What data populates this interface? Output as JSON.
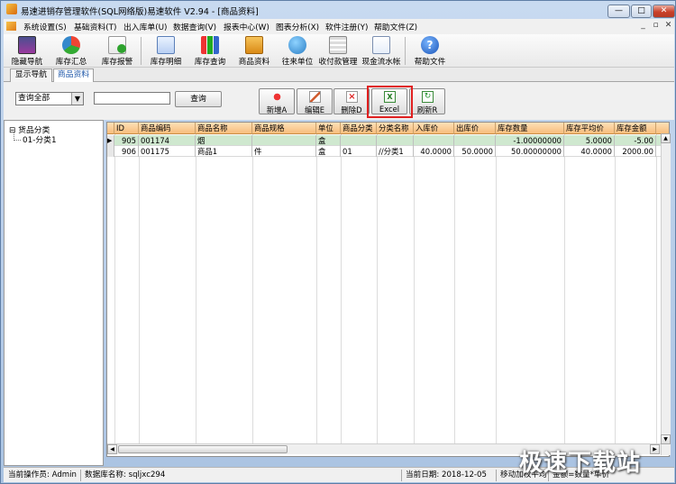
{
  "window": {
    "title": "易速进销存管理软件(SQL网络版)易速软件 V2.94 - [商品资料]"
  },
  "menu": [
    "系统设置(S)",
    "基础资料(T)",
    "出入库单(U)",
    "数据查询(V)",
    "报表中心(W)",
    "图表分析(X)",
    "软件注册(Y)",
    "帮助文件(Z)"
  ],
  "toolbar": [
    "隐藏导航",
    "库存汇总",
    "库存报警",
    "库存明细",
    "库存查询",
    "商品资料",
    "往来单位",
    "收付款管理",
    "现金流水帐",
    "帮助文件"
  ],
  "tabs": [
    "显示导航",
    "商品资料"
  ],
  "filter": {
    "combo_value": "查询全部",
    "search_value": "",
    "query_label": "查询"
  },
  "actions": [
    "新增A",
    "编辑E",
    "删除D",
    "Excel",
    "刷新R"
  ],
  "tree": {
    "root": "货品分类",
    "child": "01-分类1"
  },
  "grid": {
    "columns": [
      "ID",
      "商品编码",
      "商品名称",
      "商品规格",
      "单位",
      "商品分类",
      "分类名称",
      "入库价",
      "出库价",
      "库存数量",
      "库存平均价",
      "库存金额"
    ],
    "rows": [
      [
        "905",
        "001174",
        "烟",
        "",
        "盒",
        "",
        "",
        "",
        "",
        "-1.00000000",
        "5.0000",
        "-5.00"
      ],
      [
        "906",
        "001175",
        "商品1",
        "件",
        "盒",
        "01",
        "//分类1",
        "40.0000",
        "50.0000",
        "50.00000000",
        "40.0000",
        "2000.00"
      ]
    ]
  },
  "status": {
    "operator": "当前操作员: Admin",
    "db": "数据库名称: sqljxc294",
    "date": "当前日期: 2018-12-05",
    "method": "移动加权平均",
    "formula": "金额=数量*单价"
  },
  "watermark": "极速下载站"
}
